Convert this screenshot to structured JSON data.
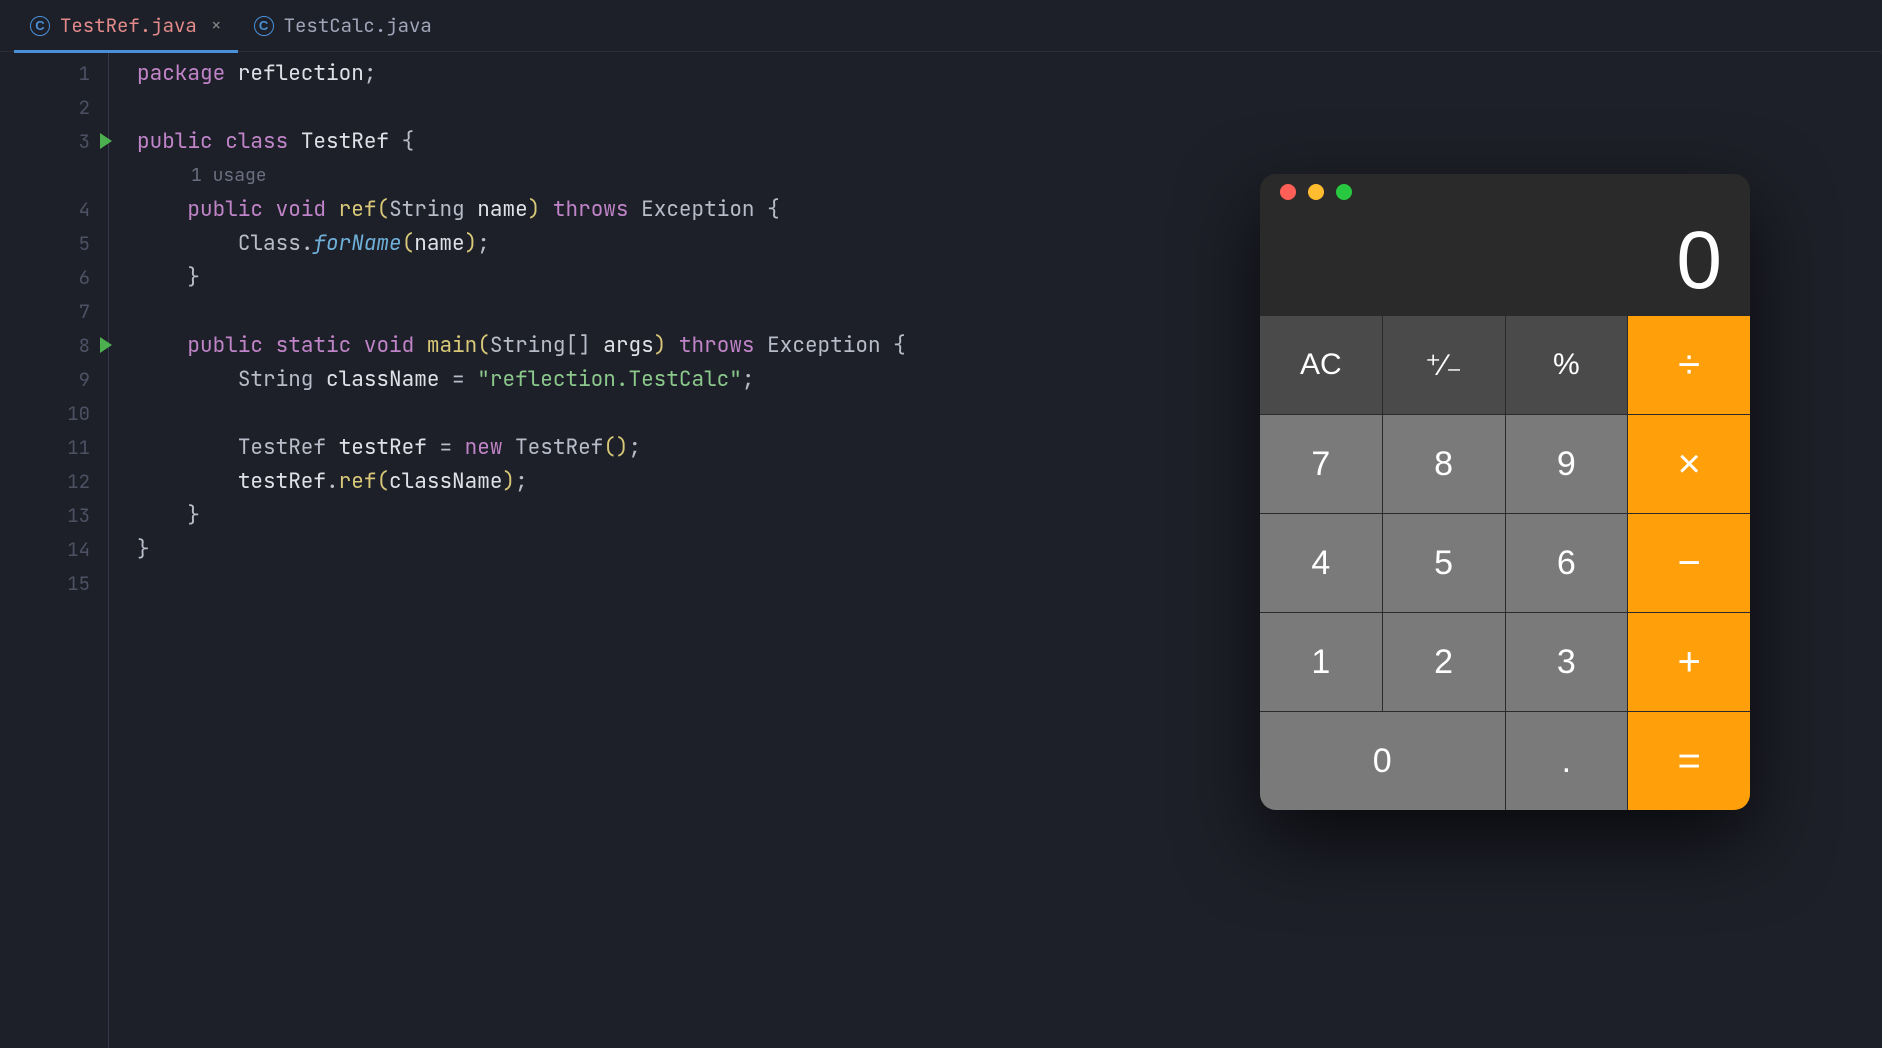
{
  "tabs": [
    {
      "name": "TestRef.java",
      "active": true
    },
    {
      "name": "TestCalc.java",
      "active": false
    }
  ],
  "gutter": {
    "lines": [
      "1",
      "2",
      "3",
      "4",
      "5",
      "6",
      "7",
      "8",
      "9",
      "10",
      "11",
      "12",
      "13",
      "14",
      "15"
    ],
    "run_markers": [
      3,
      8
    ]
  },
  "hint": "1 usage",
  "code": {
    "l1": {
      "kw": "package",
      "name": " reflection",
      "sc": ";"
    },
    "l3": {
      "kw1": "public",
      "kw2": "class",
      "cls": "TestRef",
      "brace": "{"
    },
    "l4": {
      "kw1": "public",
      "kw2": "void",
      "method": "ref",
      "lp": "(",
      "ptype": "String",
      "pname": "name",
      "rp": ")",
      "throws": "throws",
      "ex": "Exception",
      "brace": "{"
    },
    "l5": {
      "cls": "Class",
      "dot": ".",
      "method": "forName",
      "lp": "(",
      "arg": "name",
      "rp": ")",
      "sc": ";"
    },
    "l6": {
      "brace": "}"
    },
    "l8": {
      "kw1": "public",
      "kw2": "static",
      "kw3": "void",
      "method": "main",
      "lp": "(",
      "ptype": "String[]",
      "pname": "args",
      "rp": ")",
      "throws": "throws",
      "ex": "Exception",
      "brace": "{"
    },
    "l9": {
      "type": "String",
      "var": "className",
      "eq": "=",
      "str": "\"reflection.TestCalc\"",
      "sc": ";"
    },
    "l11": {
      "type": "TestRef",
      "var": "testRef",
      "eq": "=",
      "kw": "new",
      "ctor": "TestRef",
      "lp": "(",
      "rp": ")",
      "sc": ";"
    },
    "l12": {
      "obj": "testRef",
      "dot": ".",
      "method": "ref",
      "lp": "(",
      "arg": "className",
      "rp": ")",
      "sc": ";"
    },
    "l13": {
      "brace": "}"
    },
    "l14": {
      "brace": "}"
    }
  },
  "calc": {
    "display": "0",
    "buttons": {
      "ac": "AC",
      "sign": "⁺∕₋",
      "pct": "%",
      "div": "÷",
      "b7": "7",
      "b8": "8",
      "b9": "9",
      "mul": "×",
      "b4": "4",
      "b5": "5",
      "b6": "6",
      "sub": "−",
      "b1": "1",
      "b2": "2",
      "b3": "3",
      "add": "+",
      "b0": "0",
      "dot": ".",
      "eq": "="
    }
  }
}
